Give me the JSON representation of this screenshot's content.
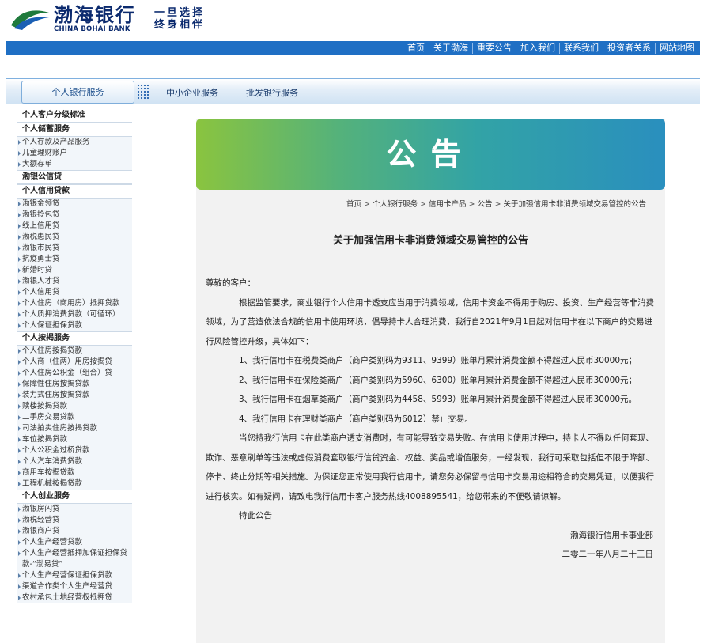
{
  "brand": {
    "name_cn": "渤海银行",
    "name_en": "CHINA BOHAI BANK",
    "slogan_line1": "一旦选择",
    "slogan_line2": "终身相伴"
  },
  "top_nav": [
    "首页",
    "关于渤海",
    "重要公告",
    "加入我们",
    "联系我们",
    "投资者关系",
    "网站地图"
  ],
  "sub_nav": {
    "active": "个人银行服务",
    "items": [
      "中小企业服务",
      "批发银行服务"
    ]
  },
  "sidebar": [
    {
      "heading": "个人客户分级标准",
      "items": []
    },
    {
      "heading": "个人储蓄服务",
      "items": [
        "个人存款及产品服务",
        "儿童理财账户",
        "大额存单"
      ]
    },
    {
      "heading": "渤银公信贷",
      "items": []
    },
    {
      "heading": "个人信用贷款",
      "items": [
        "渤银金领贷",
        "渤银拎包贷",
        "线上信用贷",
        "渤税惠民贷",
        "渤银市民贷",
        "抗疫勇士贷",
        "新婚时贷",
        "渤银人才贷",
        "个人信用贷",
        "个人住房（商用房）抵押贷款",
        "个人质押消费贷款（可循环）",
        "个人保证担保贷款"
      ]
    },
    {
      "heading": "个人按揭服务",
      "items": [
        "个人住房按揭贷款",
        "个人商（住两）用房按揭贷",
        "个人住房公积金（组合）贷",
        "保障性住房按揭贷款",
        "装力式住房按揭贷款",
        "赎楼按揭贷款",
        "二手房交易贷款",
        "司法拍卖住房按揭贷款",
        "车位按揭贷款",
        "个人公积金过桥贷款",
        "个人汽车消费贷款",
        "商用车按揭贷款",
        "工程机械按揭贷款"
      ]
    },
    {
      "heading": "个人创业服务",
      "items": [
        "渤银房闪贷",
        "渤税经营贷",
        "渤银商户贷",
        "个人生产经营贷款",
        "个人生产经营抵押加保证担保贷款-“渤易贷”",
        "个人生产经营保证担保贷款",
        "渠道合作类个人生产经营贷",
        "农村承包土地经营权抵押贷"
      ]
    }
  ],
  "banner_title": "公告",
  "breadcrumb": [
    "首页",
    "个人银行服务",
    "信用卡产品",
    "公告",
    "关于加强信用卡非消费领域交易管控的公告"
  ],
  "notice": {
    "title": "关于加强信用卡非消费领域交易管控的公告",
    "greeting": "尊敬的客户：",
    "intro": "根据监管要求，商业银行个人信用卡透支应当用于消费领域，信用卡资金不得用于购房、投资、生产经营等非消费领域，为了营造依法合规的信用卡使用环境，倡导持卡人合理消费，我行自2021年9月1日起对信用卡在以下商户的交易进行风险管控升级，具体如下：",
    "item1": "1、我行信用卡在税费类商户（商户类别码为9311、9399）账单月累计消费金额不得超过人民币30000元；",
    "item2": "2、我行信用卡在保险类商户（商户类别码为5960、6300）账单月累计消费金额不得超过人民币30000元；",
    "item3": "3、我行信用卡在烟草类商户（商户类别码为4458、5993）账单月累计消费金额不得超过人民币30000元。",
    "item4": "4、我行信用卡在理财类商户（商户类别码为6012）禁止交易。",
    "closing": "当您持我行信用卡在此类商户透支消费时，有可能导致交易失败。在信用卡使用过程中，持卡人不得以任何套现、欺诈、恶意刷单等违法或虚假消费套取银行信贷资金、权益、奖品或增值服务，一经发现，我行可采取包括但不限于降额、停卡、终止分期等相关措施。为保证您正常使用我行信用卡，请您务必保留与信用卡交易用途相符合的交易凭证，以便我行进行核实。如有疑问，请致电我行信用卡客户服务热线4008895541，给您带来的不便敬请谅解。",
    "special": "特此公告",
    "signer": "渤海银行信用卡事业部",
    "date": "二零二一年八月二十三日"
  },
  "colors": {
    "nav_blue": "#1f6fc4",
    "brand_navy": "#0b2a6e",
    "banner_green": "#8ac43f",
    "banner_blue": "#2a8fbe"
  }
}
